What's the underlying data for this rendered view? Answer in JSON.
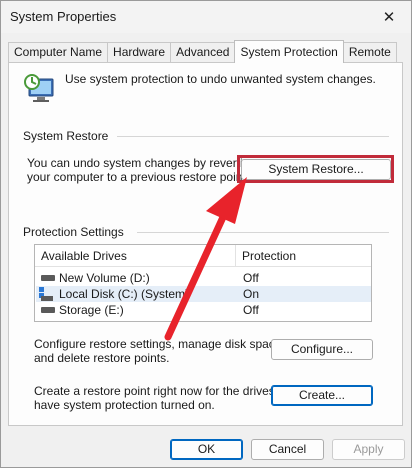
{
  "window": {
    "title": "System Properties",
    "close_glyph": "✕"
  },
  "tabs": [
    {
      "label": "Computer Name"
    },
    {
      "label": "Hardware"
    },
    {
      "label": "Advanced"
    },
    {
      "label": "System Protection"
    },
    {
      "label": "Remote"
    }
  ],
  "active_tab": "System Protection",
  "intro": {
    "text": "Use system protection to undo unwanted system changes.",
    "icon": "system-protection-icon"
  },
  "system_restore": {
    "group_label": "System Restore",
    "desc_line1": "You can undo system changes by reverting",
    "desc_line2": "your computer to a previous restore point.",
    "button_label": "System Restore..."
  },
  "protection_settings": {
    "group_label": "Protection Settings",
    "columns": [
      "Available Drives",
      "Protection"
    ],
    "drives": [
      {
        "name": "New Volume (D:)",
        "protection": "Off",
        "icon": "drive-icon"
      },
      {
        "name": "Local Disk (C:) (System)",
        "protection": "On",
        "icon": "windows-drive-icon",
        "selected": true
      },
      {
        "name": "Storage (E:)",
        "protection": "Off",
        "icon": "drive-icon"
      }
    ],
    "configure_desc_line1": "Configure restore settings, manage disk space,",
    "configure_desc_line2": "and delete restore points.",
    "configure_label": "Configure...",
    "create_desc_line1": "Create a restore point right now for the drives that",
    "create_desc_line2": "have system protection turned on.",
    "create_label": "Create..."
  },
  "footer": {
    "ok_label": "OK",
    "cancel_label": "Cancel",
    "apply_label": "Apply"
  },
  "colors": {
    "annotation_red": "#e8232b",
    "highlight_border": "#c12b3a",
    "accent": "#0067c0"
  }
}
